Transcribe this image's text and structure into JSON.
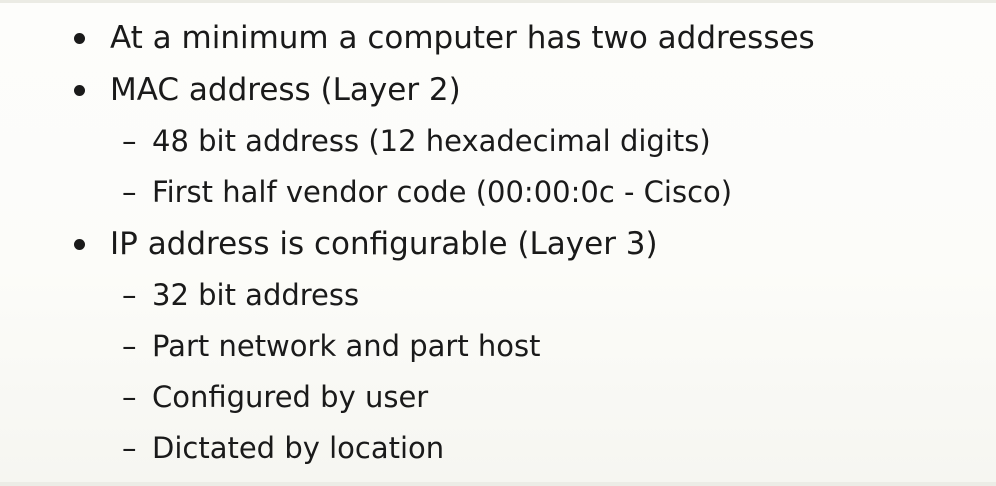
{
  "bullets": [
    {
      "text": "At a minimum a computer has two addresses",
      "sub": []
    },
    {
      "text": "MAC address (Layer 2)",
      "sub": [
        "48 bit address (12 hexadecimal digits)",
        "First half vendor code (00:00:0c - Cisco)"
      ]
    },
    {
      "text": "IP address is configurable (Layer 3)",
      "sub": [
        "32 bit address",
        "Part network and part host",
        "Configured by user",
        "Dictated by location"
      ]
    }
  ],
  "glyphs": {
    "bullet": "•",
    "dash": "–"
  },
  "colors": {
    "text": "#1a1a1a",
    "background": "#fcfcf9"
  }
}
